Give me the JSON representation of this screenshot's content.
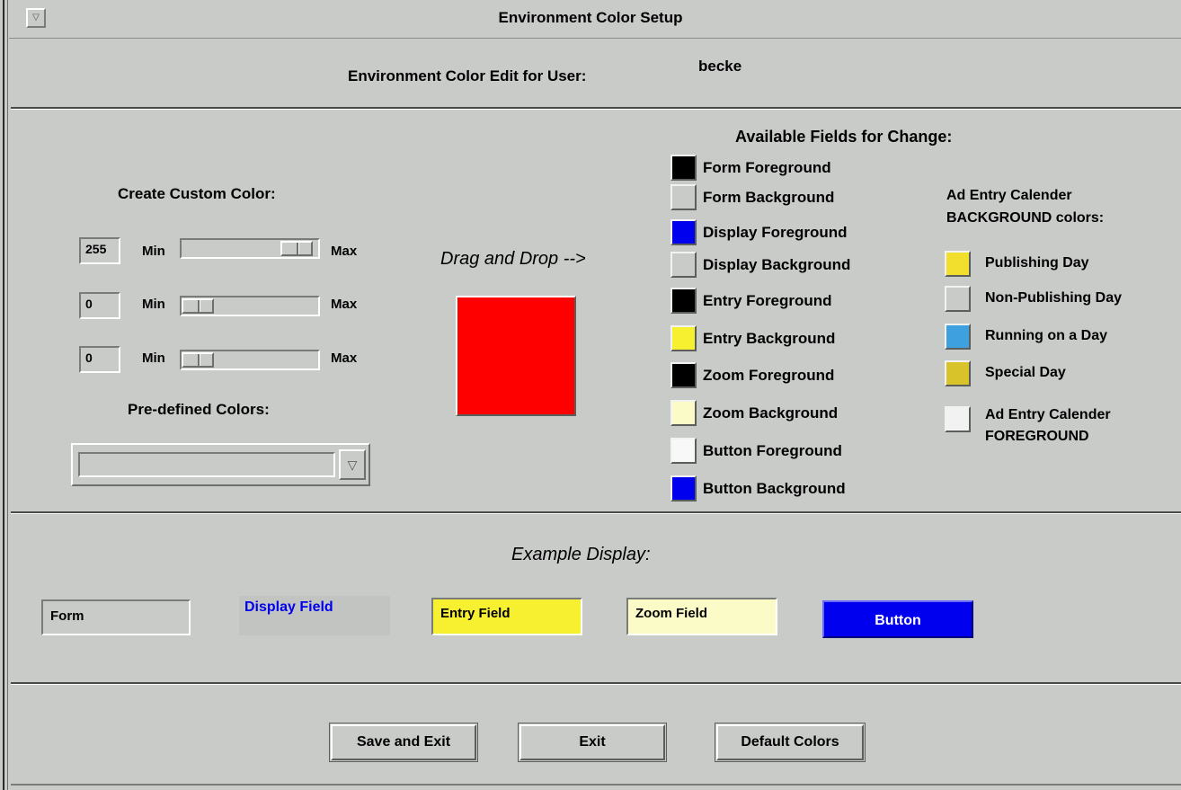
{
  "window": {
    "title": "Environment Color Setup"
  },
  "header": {
    "label": "Environment Color Edit for User:",
    "user": "becke"
  },
  "custom_color": {
    "title": "Create Custom Color:",
    "min_label": "Min",
    "max_label": "Max",
    "sliders": [
      {
        "value": "255",
        "level": 1.0
      },
      {
        "value": "0",
        "level": 0.0
      },
      {
        "value": "0",
        "level": 0.0
      }
    ],
    "predefined_title": "Pre-defined Colors:",
    "predefined_selected": ""
  },
  "drag": {
    "label": "Drag and Drop -->",
    "preview_color": "#ff0000"
  },
  "fields": {
    "title": "Available Fields for Change:",
    "items": [
      {
        "label": "Form Foreground",
        "color": "#000000"
      },
      {
        "label": "Form Background",
        "color": "#c9cbc9"
      },
      {
        "label": "Display Foreground",
        "color": "#0000ee"
      },
      {
        "label": "Display Background",
        "color": "#c9cbc9"
      },
      {
        "label": "Entry Foreground",
        "color": "#000000"
      },
      {
        "label": "Entry Background",
        "color": "#f7f030"
      },
      {
        "label": "Zoom Foreground",
        "color": "#000000"
      },
      {
        "label": "Zoom Background",
        "color": "#fbfbc8"
      },
      {
        "label": "Button Foreground",
        "color": "#f8f8f8"
      },
      {
        "label": "Button Background",
        "color": "#0000ee"
      }
    ]
  },
  "calendar": {
    "title_line1": "Ad Entry Calender",
    "title_line2": "BACKGROUND colors:",
    "items": [
      {
        "label": "Publishing Day",
        "color": "#f2de2c"
      },
      {
        "label": "Non-Publishing Day",
        "color": "#c9cbc9"
      },
      {
        "label": "Running on a Day",
        "color": "#3fa0e0"
      },
      {
        "label": "Special Day",
        "color": "#d8c42a"
      }
    ],
    "fg_label_line1": "Ad Entry Calender",
    "fg_label_line2": "FOREGROUND",
    "fg_color": "#f2f2f2"
  },
  "example": {
    "title": "Example Display:",
    "form": "Form",
    "display": "Display Field",
    "entry": "Entry Field",
    "zoom": "Zoom Field",
    "button": "Button"
  },
  "actions": {
    "save": "Save and Exit",
    "exit": "Exit",
    "default": "Default Colors"
  }
}
